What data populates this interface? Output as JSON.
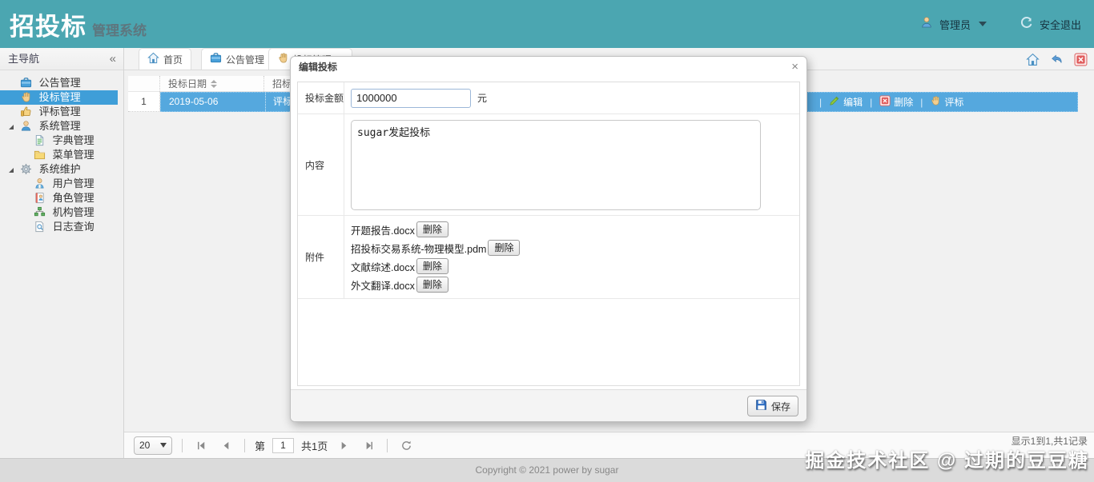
{
  "header": {
    "brand_bold": "招投标",
    "brand_rest": "管理系统",
    "user_label": "管理员",
    "logout_label": "安全退出"
  },
  "sidebar": {
    "title": "主导航",
    "collapse_glyph": "«",
    "items": [
      {
        "label": "公告管理",
        "icon": "briefcase-icon",
        "level": 1,
        "selected": false
      },
      {
        "label": "投标管理",
        "icon": "hand-icon",
        "level": 1,
        "selected": true
      },
      {
        "label": "评标管理",
        "icon": "thumbs-up-icon",
        "level": 1,
        "selected": false
      },
      {
        "label": "系统管理",
        "icon": "people-icon",
        "level": 1,
        "expanded": true
      },
      {
        "label": "字典管理",
        "icon": "document-icon",
        "level": 2
      },
      {
        "label": "菜单管理",
        "icon": "folder-icon",
        "level": 2
      },
      {
        "label": "系统维护",
        "icon": "gear-icon",
        "level": 1,
        "expanded": true
      },
      {
        "label": "用户管理",
        "icon": "user-icon",
        "level": 2
      },
      {
        "label": "角色管理",
        "icon": "role-icon",
        "level": 2
      },
      {
        "label": "机构管理",
        "icon": "org-icon",
        "level": 2
      },
      {
        "label": "日志查询",
        "icon": "log-search-icon",
        "level": 2
      }
    ]
  },
  "tabs": {
    "close_glyph": "×",
    "items": [
      {
        "label": "首页",
        "icon": "home-icon",
        "closable": false
      },
      {
        "label": "公告管理",
        "icon": "briefcase-icon",
        "closable": true
      },
      {
        "label": "投标管理",
        "icon": "hand-icon",
        "closable": true
      }
    ]
  },
  "grid": {
    "columns": [
      {
        "label": "投标日期",
        "sortable": true
      },
      {
        "label": "招标状态",
        "sortable": false
      }
    ],
    "rows": [
      {
        "num": "1",
        "date": "2019-05-06",
        "status": "评标中",
        "actions": [
          {
            "label": "编辑",
            "icon": "edit-icon"
          },
          {
            "label": "删除",
            "icon": "delete-icon"
          },
          {
            "label": "评标",
            "icon": "hand-icon"
          }
        ]
      }
    ]
  },
  "pager": {
    "page_size": "20",
    "page_prefix": "第",
    "page_value": "1",
    "page_suffix": "共1页",
    "info": "显示1到1,共1记录"
  },
  "dialog": {
    "title": "编辑投标",
    "close_glyph": "×",
    "amount": {
      "label": "投标金额",
      "value": "1000000",
      "unit": "元"
    },
    "content": {
      "label": "内容",
      "value": "sugar发起投标"
    },
    "attachments": {
      "label": "附件",
      "delete_label": "删除",
      "files": [
        "开题报告.docx",
        "招投标交易系统-物理模型.pdm",
        "文献综述.docx",
        "外文翻译.docx"
      ]
    },
    "save_label": "保存"
  },
  "footer": {
    "copyright": "Copyright © 2021 power by sugar"
  },
  "watermark": {
    "text": "掘金技术社区 @ 过期的豆豆糖"
  },
  "colors": {
    "header_teal": "#4ba6b1",
    "nav_selected_blue": "#3f9ed8",
    "row_selected_blue": "#55a8de",
    "danger_red": "#e05c5c"
  },
  "icons": {
    "briefcase-icon": "blue briefcase",
    "hand-icon": "raised hand",
    "thumbs-up-icon": "thumb up",
    "people-icon": "person bust",
    "document-icon": "page with lines",
    "folder-icon": "yellow folder",
    "gear-icon": "cog wheel",
    "user-icon": "user bust",
    "role-icon": "id card",
    "org-icon": "org chart",
    "log-search-icon": "page with magnifier",
    "home-icon": "house",
    "back-icon": "curved undo arrow",
    "close-red-icon": "red x box",
    "edit-icon": "green pencil",
    "delete-icon": "red x box",
    "save-icon": "floppy disk",
    "refresh-icon": "circular arrow",
    "logout-icon": "power arc",
    "avatar-icon": "small user avatar"
  }
}
